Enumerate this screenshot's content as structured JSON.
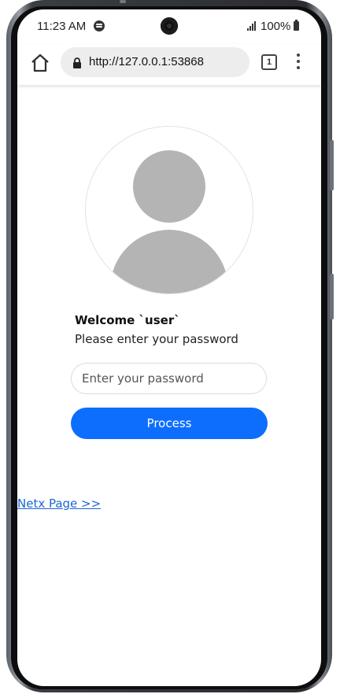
{
  "status_bar": {
    "time": "11:23 AM",
    "battery": "100%",
    "icons": [
      "spotify-icon",
      "signal-icon",
      "battery-icon"
    ]
  },
  "browser": {
    "url": "http://127.0.0.1:53868",
    "tab_count": "1",
    "icons": [
      "home-icon",
      "lock-icon",
      "tabs-icon",
      "more-vert-icon"
    ]
  },
  "login": {
    "welcome": "Welcome `user`",
    "prompt": "Please enter your password",
    "password_value": "",
    "password_placeholder": "Enter your password",
    "process_label": "Process",
    "accent_color": "#0d6efd"
  },
  "footer": {
    "next_link": "Netx Page >>"
  },
  "colors": {
    "accent": "#0d6efd",
    "link": "#1a66d6",
    "avatar_gray": "#b4b4b4"
  }
}
